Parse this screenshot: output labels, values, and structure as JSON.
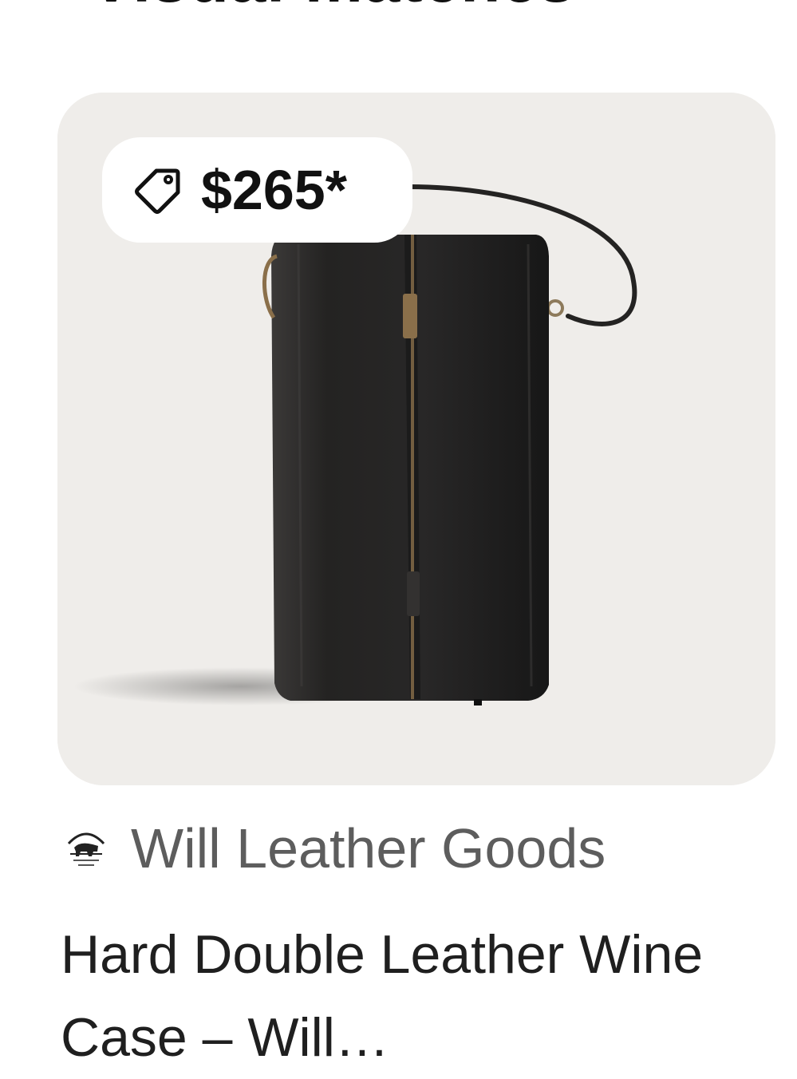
{
  "section": {
    "title": "Visual matches"
  },
  "product": {
    "price": "$265*",
    "seller": "Will Leather Goods",
    "title": "Hard Double Leather Wine Case – Will…"
  },
  "icons": {
    "price_tag": "tag-icon",
    "seller_logo": "seller-logo-icon"
  },
  "colors": {
    "image_background": "#efedea",
    "case_leather": "#252424",
    "zipper": "#8a6f4a",
    "seller_text": "#5d5d5d",
    "title_text": "#1f1f1f"
  }
}
